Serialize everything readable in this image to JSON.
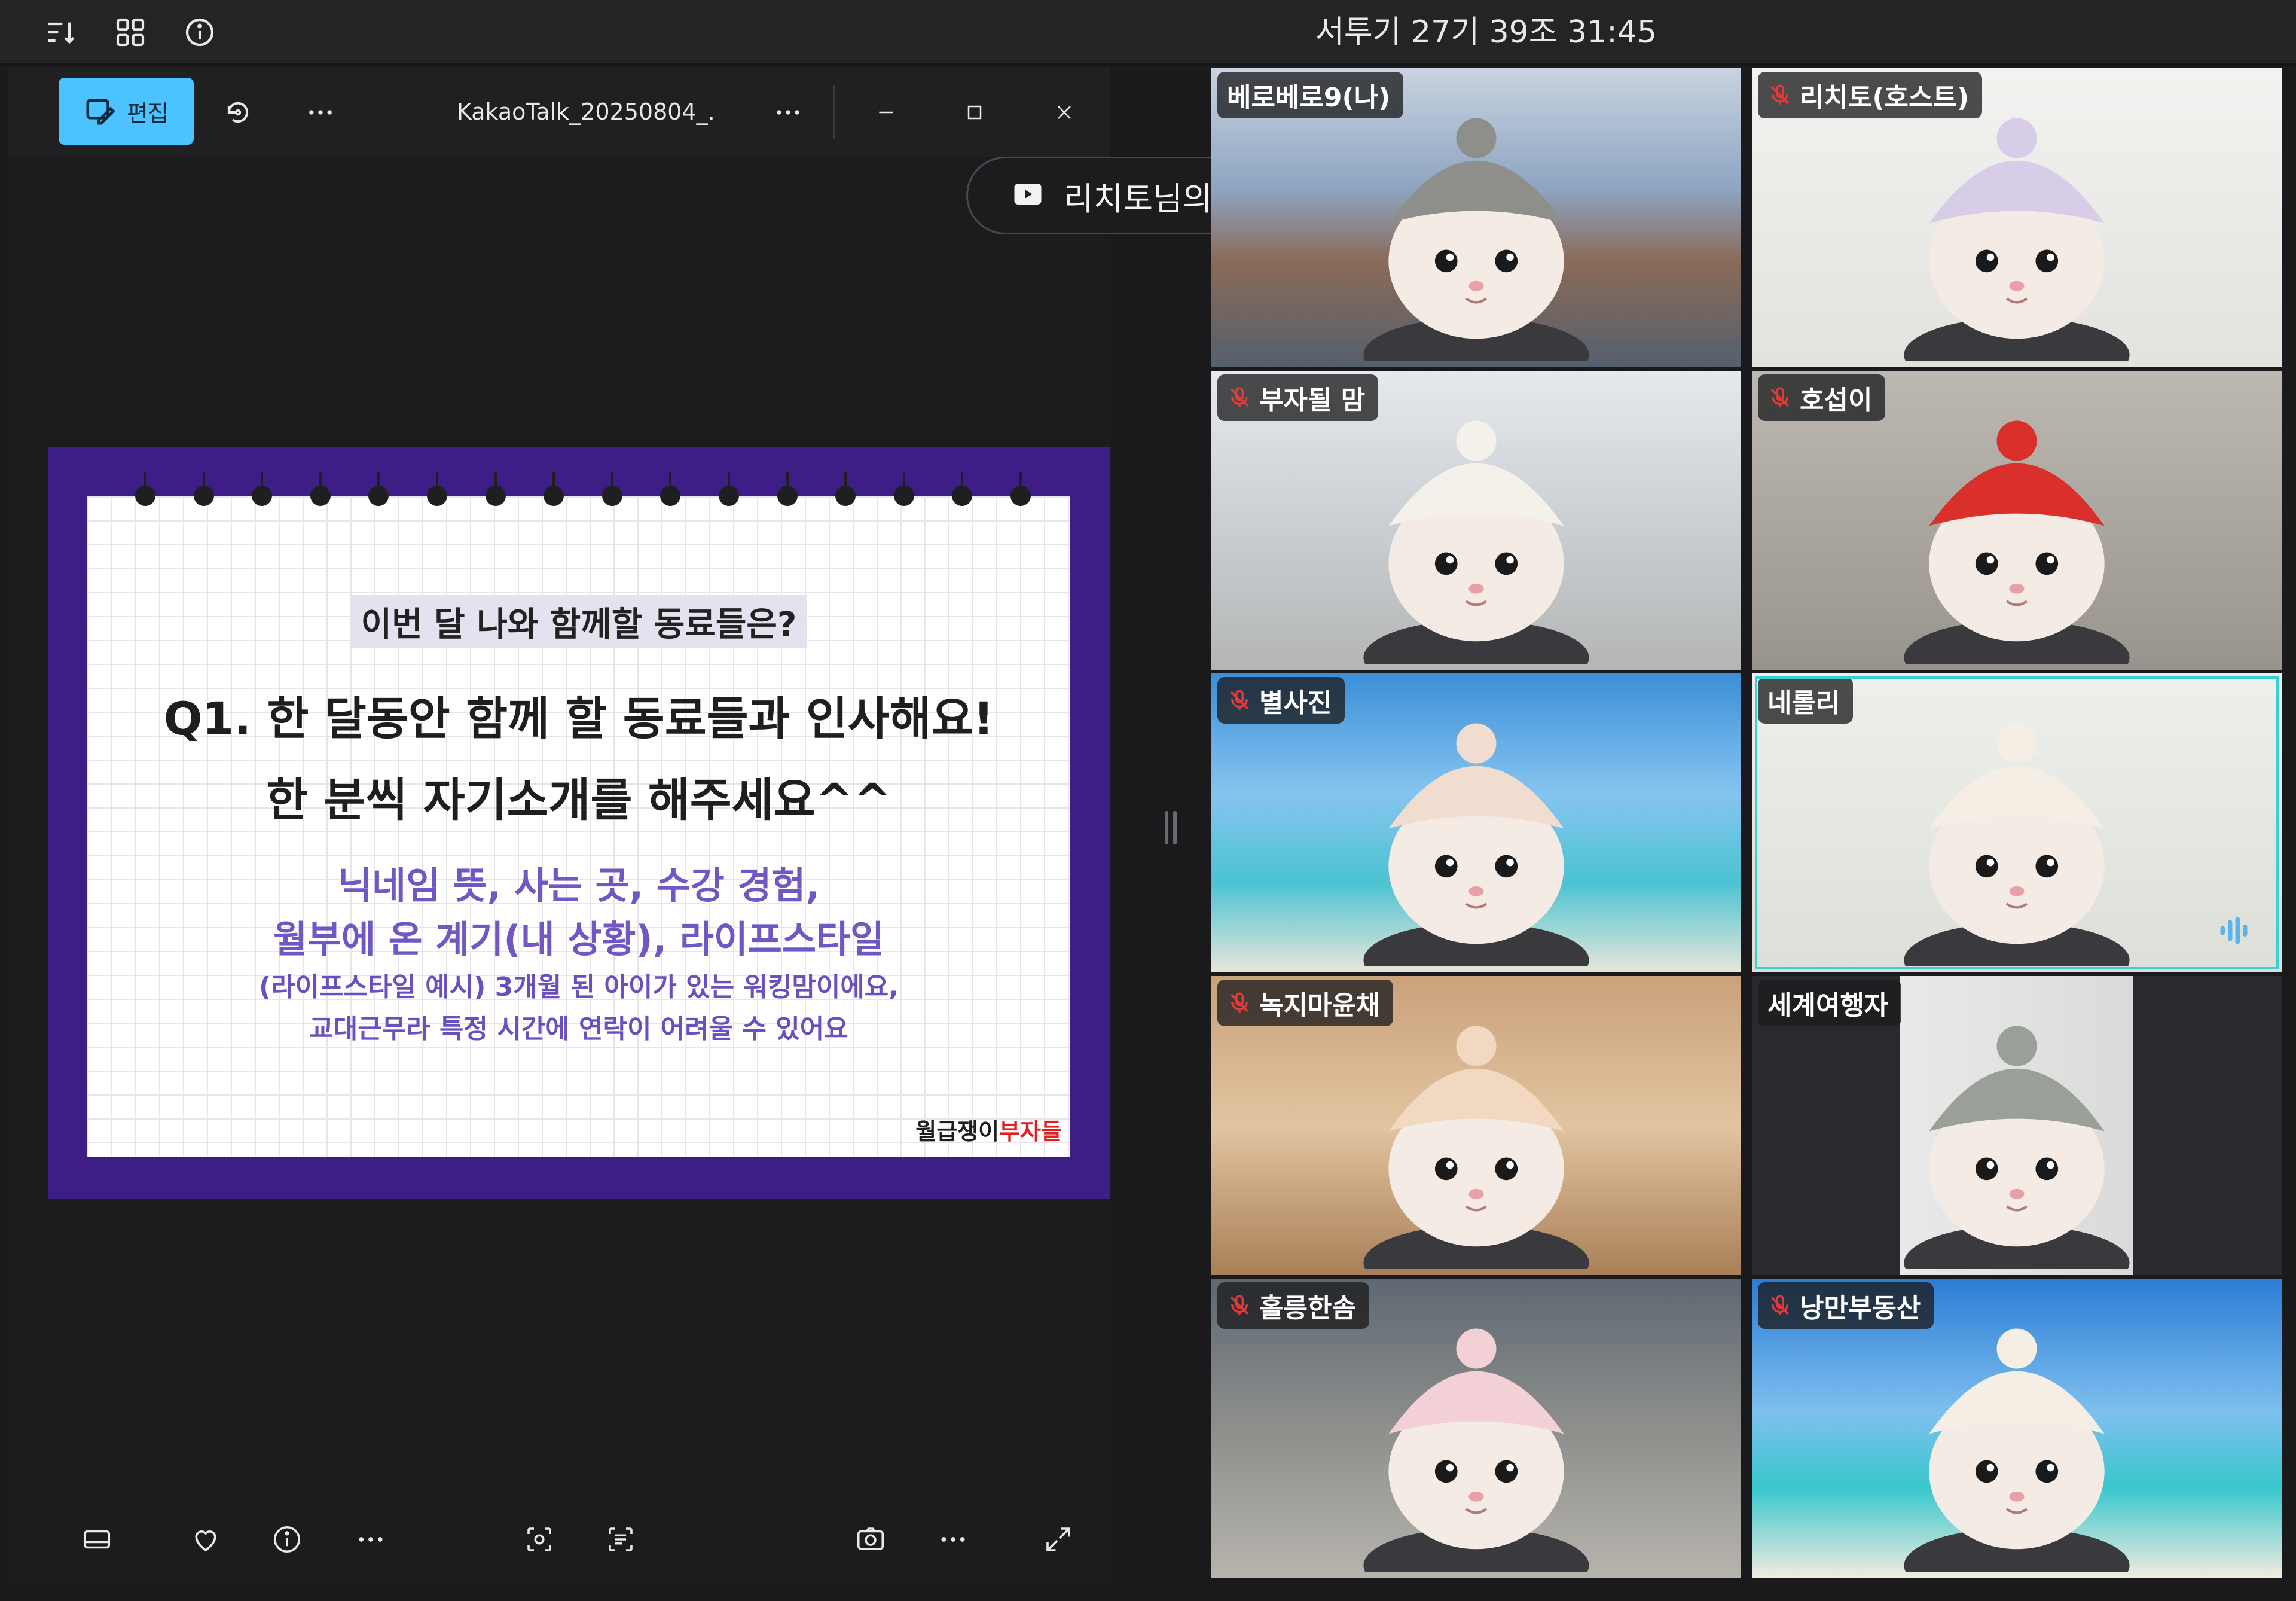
{
  "meeting": {
    "title": "서투기 27기 39조 31:45",
    "toolbar_icons": [
      "sort-icon",
      "grid-view-icon",
      "info-icon"
    ]
  },
  "viewer": {
    "edit_label": "편집",
    "file_name": "KakaoTalk_20250804_...",
    "title_icons": [
      "edit-icon",
      "rotate-icon",
      "more-icon",
      "more-icon",
      "minimize-icon",
      "maximize-icon",
      "close-icon"
    ],
    "bottom_icons": [
      "film-strip-icon",
      "heart-icon",
      "info-icon",
      "more-icon",
      "face-scan-icon",
      "text-scan-icon",
      "screenshot-icon",
      "more-icon",
      "fullscreen-icon"
    ]
  },
  "slide": {
    "subtitle": "이번 달 나와 함께할 동료들은?",
    "q1_line1": "Q1. 한 달동안 함께 할 동료들과 인사해요!",
    "q1_line2": "한 분씩 자기소개를 해주세요^^",
    "detail_line1": "닉네임 뜻, 사는 곳, 수강 경험,",
    "detail_line2": "월부에 온 계기(내 상황), 라이프스타일",
    "example_line1": "(라이프스타일 예시) 3개월 된 아이가 있는 워킹맘이에요,",
    "example_line2": "교대근무라 특정 시간에 연락이 어려울 수 있어요",
    "brand_black": "월급쟁이",
    "brand_red": "부자들",
    "colors": {
      "frame": "#3d1e86",
      "accent_text": "#7157c4",
      "brand_red": "#e02020"
    }
  },
  "share_pill": {
    "label": "리치토님의 화면",
    "icon": "screen-share-icon"
  },
  "participants": [
    {
      "name": "베로베로9(나)",
      "muted": false,
      "speaking": false
    },
    {
      "name": "리치토(호스트)",
      "muted": true,
      "speaking": false
    },
    {
      "name": "부자될 맘",
      "muted": true,
      "speaking": false
    },
    {
      "name": "호섭이",
      "muted": true,
      "speaking": false
    },
    {
      "name": "별사진",
      "muted": true,
      "speaking": false
    },
    {
      "name": "네롤리",
      "muted": false,
      "speaking": true
    },
    {
      "name": "녹지마윤채",
      "muted": true,
      "speaking": false
    },
    {
      "name": "세계여행자",
      "muted": false,
      "speaking": false
    },
    {
      "name": "홀릉한솜",
      "muted": true,
      "speaking": false
    },
    {
      "name": "낭만부동산",
      "muted": true,
      "speaking": false
    }
  ],
  "colors": {
    "speaking_border": "#20d36b",
    "edit_button": "#4cc2ff",
    "mute_icon": "#e03a3a"
  }
}
